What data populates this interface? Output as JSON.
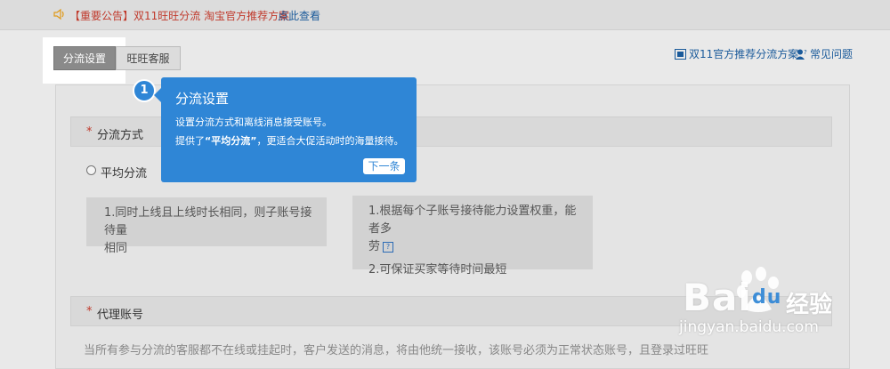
{
  "notice": {
    "tag": "【重要公告】",
    "message": "双11旺旺分流 淘宝官方推荐方案",
    "link": "点此查看"
  },
  "tabs": [
    {
      "label": "分流设置",
      "active": true
    },
    {
      "label": "旺旺客服",
      "active": false
    }
  ],
  "top_links": {
    "plan": "双11官方推荐分流方案",
    "faq": "常见问题"
  },
  "sections": {
    "mode": {
      "label": "分流方式"
    },
    "agent": {
      "label": "代理账号"
    }
  },
  "mode_option": {
    "label": "平均分流"
  },
  "desc_left": {
    "line1": "1.同时上线且上线时长相同，则子账号接待量",
    "line2": "相同"
  },
  "desc_right": {
    "line1": "1.根据每个子账号接待能力设置权重，能者多",
    "line2": "劳",
    "line3": "2.可保证买家等待时间最短"
  },
  "agent_desc": "当所有参与分流的客服都不在线或挂起时，客户发送的消息，将由他统一接收，该账号必须为正常状态账号，且登录过旺旺",
  "tooltip": {
    "step": "1",
    "title": "分流设置",
    "line1": "设置分流方式和离线消息接受账号。",
    "line2_prefix": "提供了",
    "line2_bold": "“平均分流”",
    "line2_suffix": "，更适合大促活动时的海量接待。",
    "next": "下一条"
  },
  "watermark": {
    "logo": "Bai",
    "logo_tail": "du",
    "cn": "经验",
    "url": "jingyan.baidu.com"
  },
  "colors": {
    "tooltip_bg": "#2f86d6",
    "notice_red": "#c0392b",
    "link_blue": "#1a5a9a"
  }
}
